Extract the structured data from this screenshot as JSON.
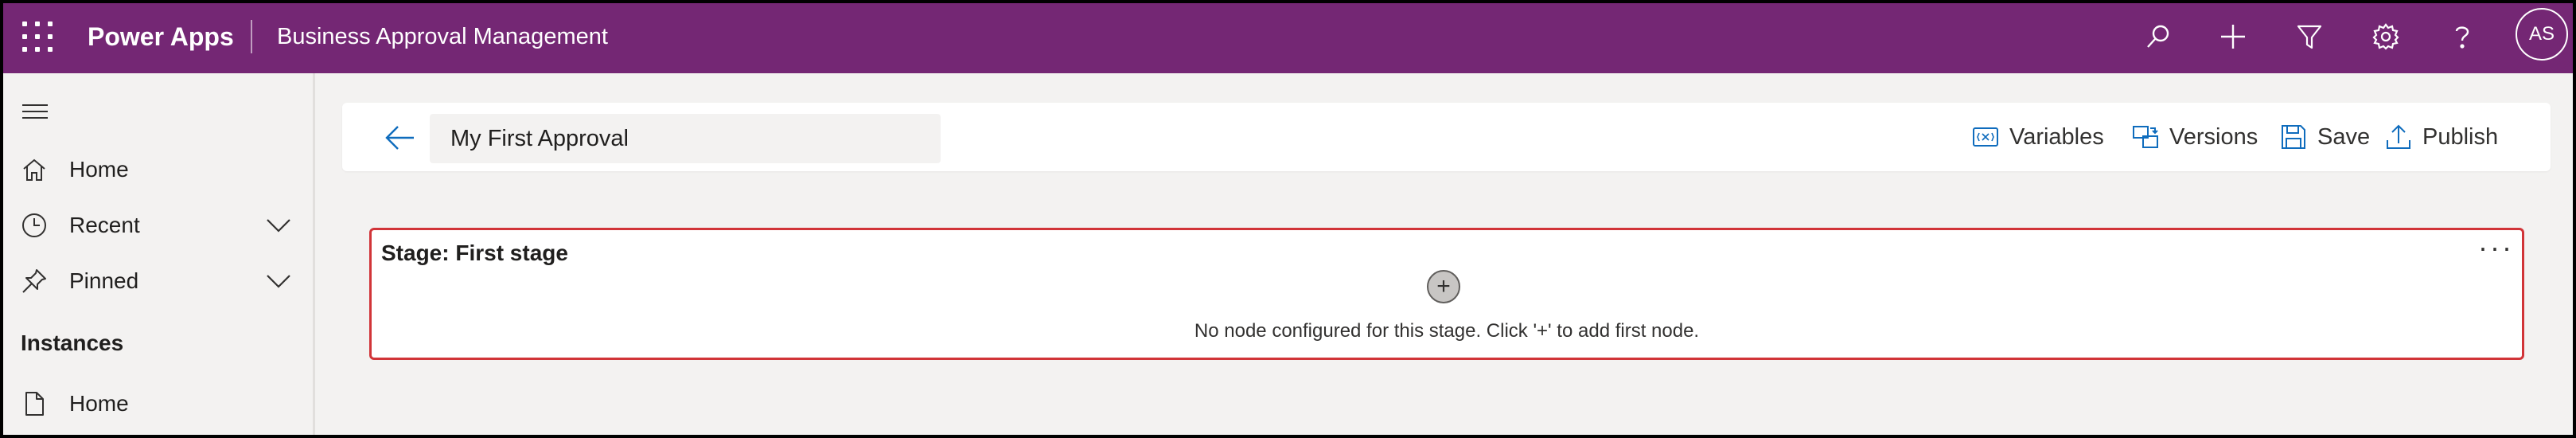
{
  "header": {
    "app_name": "Power Apps",
    "solution_name": "Business Approval Management",
    "avatar_initials": "AS",
    "icons": [
      "waffle-icon",
      "search-icon",
      "plus-icon",
      "filter-icon",
      "settings-icon",
      "help-icon"
    ],
    "background_color": "#742774"
  },
  "sidebar": {
    "items": [
      {
        "label": "Home",
        "icon": "home-icon"
      },
      {
        "label": "Recent",
        "icon": "clock-icon"
      },
      {
        "label": "Pinned",
        "icon": "pin-icon"
      }
    ],
    "section_title": "Instances",
    "section_items": [
      {
        "label": "Home",
        "icon": "document-icon"
      }
    ]
  },
  "commandbar": {
    "approval_name": "My First Approval",
    "buttons": [
      {
        "label": "Variables",
        "icon": "variables-icon"
      },
      {
        "label": "Versions",
        "icon": "versions-icon"
      },
      {
        "label": "Save",
        "icon": "save-icon"
      },
      {
        "label": "Publish",
        "icon": "publish-icon"
      }
    ]
  },
  "stage": {
    "title": "Stage: First stage",
    "add_symbol": "+",
    "message": "No node configured for this stage. Click '+' to add first node.",
    "border_color": "#d13438"
  }
}
